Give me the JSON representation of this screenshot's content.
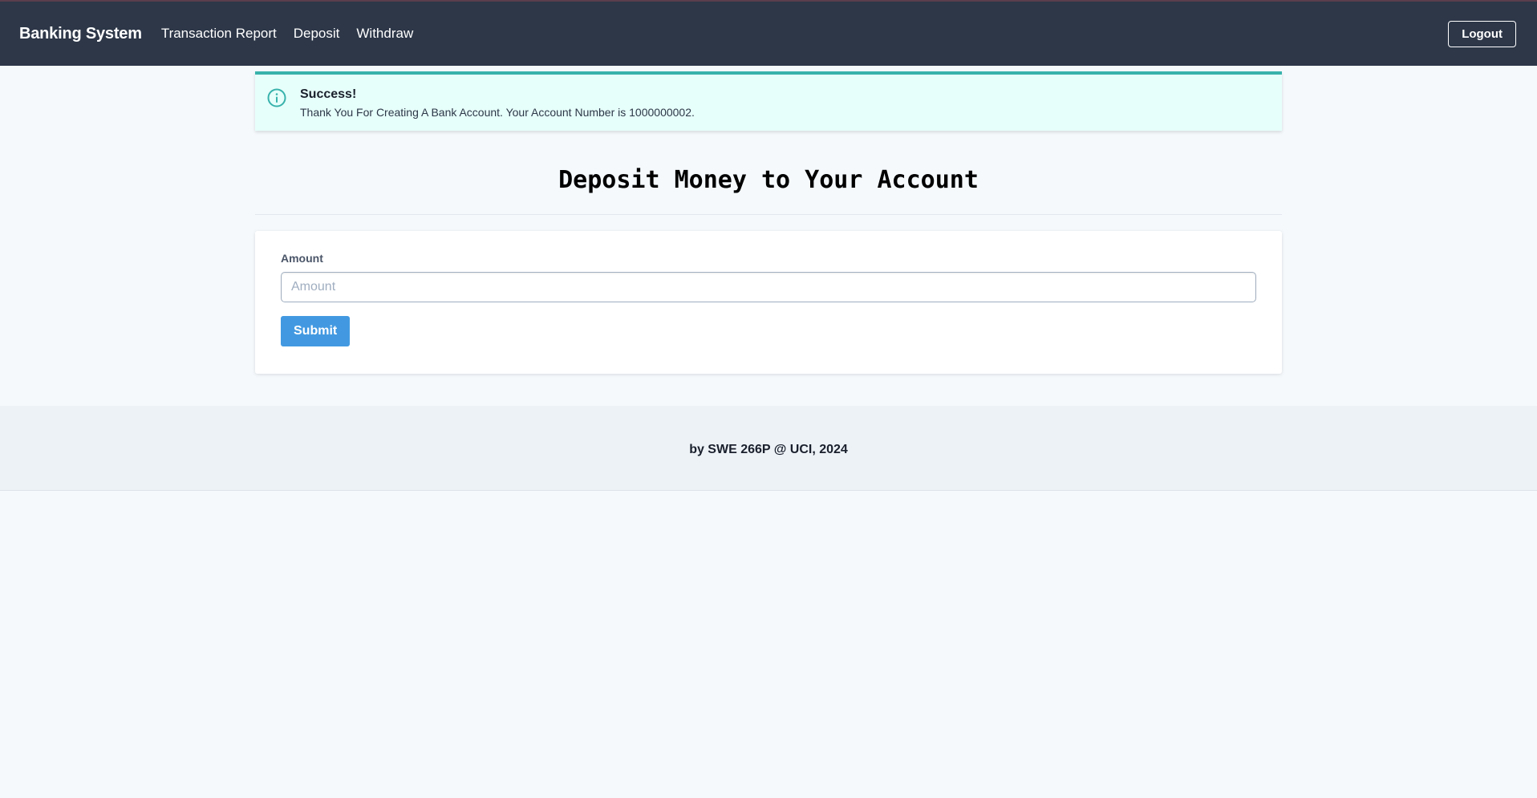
{
  "navbar": {
    "brand": "Banking System",
    "links": [
      "Transaction Report",
      "Deposit",
      "Withdraw"
    ],
    "logout_label": "Logout"
  },
  "alert": {
    "icon": "info-circle-icon",
    "title": "Success!",
    "message": "Thank You For Creating A Bank Account. Your Account Number is 1000000002."
  },
  "page": {
    "title": "Deposit Money to Your Account"
  },
  "form": {
    "amount_label": "Amount",
    "amount_value": "",
    "amount_placeholder": "Amount",
    "submit_label": "Submit"
  },
  "footer": {
    "text": "by SWE 266P @ UCI, 2024"
  },
  "colors": {
    "navbar_bg": "#2d3748",
    "alert_accent": "#38b2ac",
    "alert_bg": "#e6fffa",
    "primary_button": "#4299e1",
    "page_bg": "#f5f9fc",
    "footer_bg": "#edf2f7"
  }
}
